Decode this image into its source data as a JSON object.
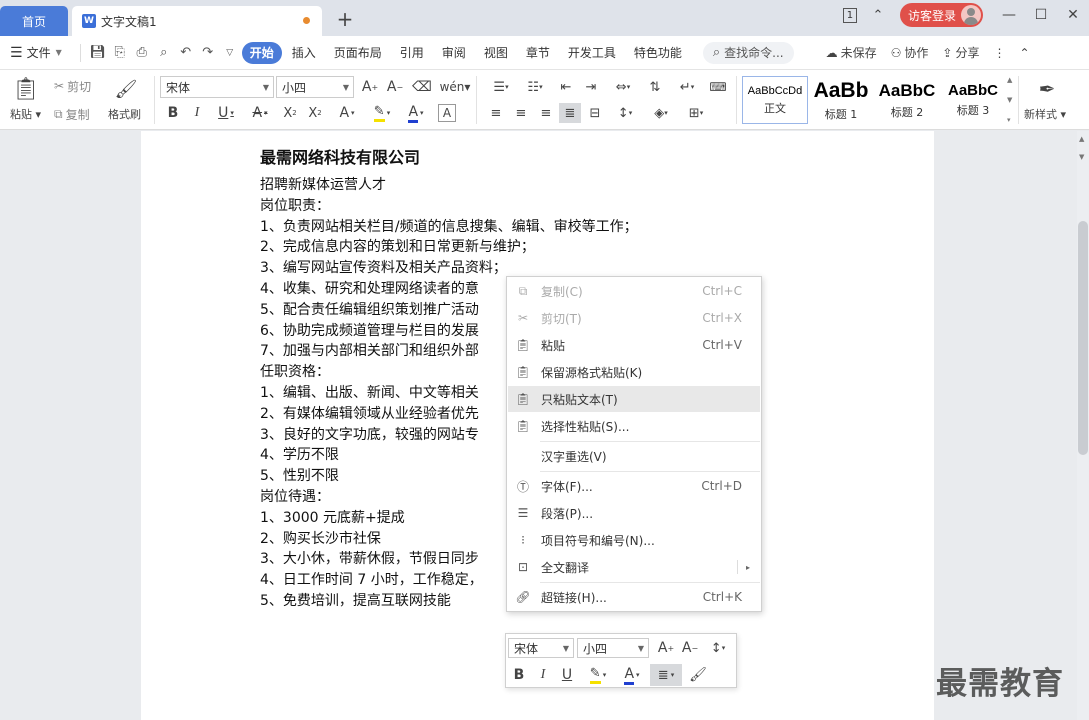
{
  "titlebar": {
    "home_tab": "首页",
    "doc_tab": "文字文稿1",
    "new_tab_icon": "+",
    "page_count_badge": "1",
    "login_label": "访客登录",
    "minimize": "—",
    "maximize": "☐",
    "close": "✕"
  },
  "menubar": {
    "file_label": "文件",
    "tabs": [
      "开始",
      "插入",
      "页面布局",
      "引用",
      "审阅",
      "视图",
      "章节",
      "开发工具",
      "特色功能"
    ],
    "search_label": "查找命令...",
    "unsaved_label": "未保存",
    "collab_label": "协作",
    "share_label": "分享",
    "more_icon": "⋮"
  },
  "ribbon": {
    "paste_label": "粘贴",
    "cut_label": "剪切",
    "copy_label": "复制",
    "format_painter_label": "格式刷",
    "font_name": "宋体",
    "font_size": "小四",
    "styles": [
      {
        "preview": "AaBbCcDd",
        "name": "正文"
      },
      {
        "preview": "AaBb",
        "name": "标题 1"
      },
      {
        "preview": "AaBbC",
        "name": "标题 2"
      },
      {
        "preview": "AaBbC",
        "name": "标题 3"
      }
    ],
    "new_style_label": "新样式"
  },
  "document": {
    "title": "最需网络科技有限公司",
    "lines": [
      "招聘新媒体运营人才",
      "岗位职责：",
      "1、负责网站相关栏目/频道的信息搜集、编辑、审校等工作；",
      "2、完成信息内容的策划和日常更新与维护；",
      "3、编写网站宣传资料及相关产品资料；",
      "4、收集、研究和处理网络读者的意",
      "5、配合责任编辑组织策划推广活动",
      "6、协助完成频道管理与栏目的发展",
      "7、加强与内部相关部门和组织外部",
      "任职资格：",
      "1、编辑、出版、新闻、中文等相关",
      "2、有媒体编辑领域从业经验者优先",
      "3、良好的文字功底，较强的网站专",
      "4、学历不限",
      "5、性别不限",
      "岗位待遇：",
      "1、3000 元底薪+提成",
      "2、购买长沙市社保",
      "3、大小休，带薪休假，节假日同步",
      "4、日工作时间 7 小时，工作稳定，",
      "5、免费培训，提高互联网技能"
    ]
  },
  "context_menu": {
    "items": [
      {
        "label": "复制(C)",
        "shortcut": "Ctrl+C",
        "icon": "copy-icon"
      },
      {
        "label": "剪切(T)",
        "shortcut": "Ctrl+X",
        "icon": "scissors-icon"
      },
      {
        "label": "粘贴",
        "shortcut": "Ctrl+V",
        "icon": "paste-icon"
      },
      {
        "label": "保留源格式粘贴(K)",
        "shortcut": "",
        "icon": "paste-keep-format-icon"
      },
      {
        "label": "只粘贴文本(T)",
        "shortcut": "",
        "icon": "paste-text-icon"
      },
      {
        "label": "选择性粘贴(S)...",
        "shortcut": "",
        "icon": "paste-special-icon"
      },
      {
        "label": "汉字重选(V)",
        "shortcut": "",
        "icon": ""
      },
      {
        "label": "字体(F)...",
        "shortcut": "Ctrl+D",
        "icon": "font-icon"
      },
      {
        "label": "段落(P)...",
        "shortcut": "",
        "icon": "paragraph-icon"
      },
      {
        "label": "项目符号和编号(N)...",
        "shortcut": "",
        "icon": "bullets-icon"
      },
      {
        "label": "全文翻译",
        "shortcut": "",
        "icon": "translate-icon"
      },
      {
        "label": "超链接(H)...",
        "shortcut": "Ctrl+K",
        "icon": "link-icon"
      }
    ]
  },
  "mini_toolbar": {
    "font_name": "宋体",
    "font_size": "小四"
  },
  "watermark": "最需教育",
  "colors": {
    "accent": "#4a7bd8",
    "login": "#e0504a",
    "highlight_yellow": "#f5e100",
    "font_red": "#e03030",
    "font_blue": "#2040d0"
  }
}
